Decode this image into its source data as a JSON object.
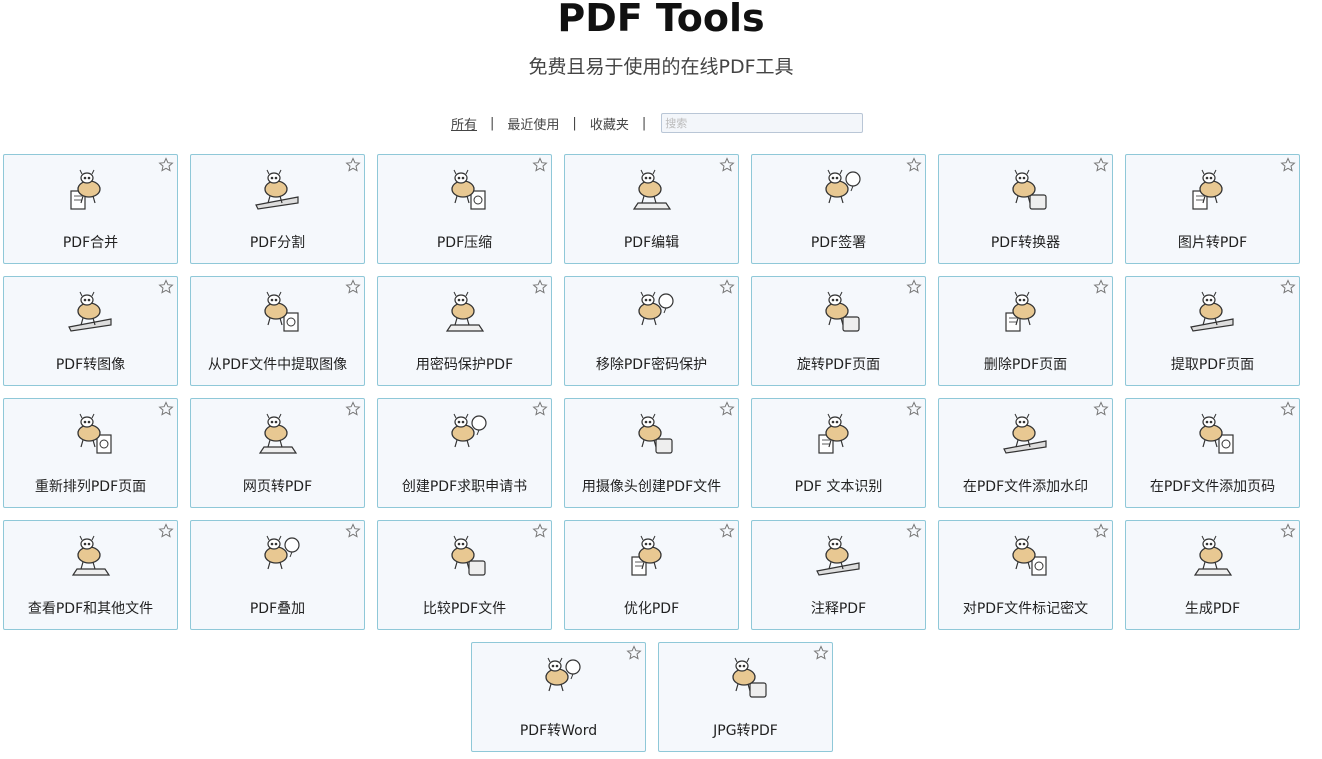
{
  "header": {
    "title": "PDF Tools",
    "subtitle": "免费且易于使用的在线PDF工具"
  },
  "filters": {
    "all": "所有",
    "recent": "最近使用",
    "favorites": "收藏夹",
    "separator": "|",
    "search_placeholder": "搜索"
  },
  "tools": [
    {
      "label": "PDF合并",
      "icon": "merge-icon"
    },
    {
      "label": "PDF分割",
      "icon": "split-icon"
    },
    {
      "label": "PDF压缩",
      "icon": "compress-icon"
    },
    {
      "label": "PDF编辑",
      "icon": "edit-icon"
    },
    {
      "label": "PDF签署",
      "icon": "sign-icon"
    },
    {
      "label": "PDF转换器",
      "icon": "converter-icon"
    },
    {
      "label": "图片转PDF",
      "icon": "image-to-pdf-icon"
    },
    {
      "label": "PDF转图像",
      "icon": "pdf-to-image-icon"
    },
    {
      "label": "从PDF文件中提取图像",
      "icon": "extract-images-icon"
    },
    {
      "label": "用密码保护PDF",
      "icon": "protect-icon"
    },
    {
      "label": "移除PDF密码保护",
      "icon": "unlock-icon"
    },
    {
      "label": "旋转PDF页面",
      "icon": "rotate-icon"
    },
    {
      "label": "删除PDF页面",
      "icon": "delete-pages-icon"
    },
    {
      "label": "提取PDF页面",
      "icon": "extract-pages-icon"
    },
    {
      "label": "重新排列PDF页面",
      "icon": "reorder-icon"
    },
    {
      "label": "网页转PDF",
      "icon": "webpage-icon"
    },
    {
      "label": "创建PDF求职申请书",
      "icon": "job-application-icon"
    },
    {
      "label": "用摄像头创建PDF文件",
      "icon": "webcam-icon"
    },
    {
      "label": "PDF 文本识别",
      "icon": "ocr-icon"
    },
    {
      "label": "在PDF文件添加水印",
      "icon": "watermark-icon"
    },
    {
      "label": "在PDF文件添加页码",
      "icon": "page-numbers-icon"
    },
    {
      "label": "查看PDF和其他文件",
      "icon": "viewer-icon"
    },
    {
      "label": "PDF叠加",
      "icon": "overlay-icon"
    },
    {
      "label": "比较PDF文件",
      "icon": "compare-icon"
    },
    {
      "label": "优化PDF",
      "icon": "optimize-icon"
    },
    {
      "label": "注释PDF",
      "icon": "annotate-icon"
    },
    {
      "label": "对PDF文件标记密文",
      "icon": "redact-icon"
    },
    {
      "label": "生成PDF",
      "icon": "create-pdf-icon"
    },
    {
      "label": "PDF转Word",
      "icon": "pdf-to-word-icon"
    },
    {
      "label": "JPG转PDF",
      "icon": "jpg-to-pdf-icon"
    }
  ],
  "colors": {
    "card_border": "#8fc8d8",
    "card_bg": "#f5f8fc",
    "mascot_body": "#e8c892",
    "ink": "#333333"
  }
}
